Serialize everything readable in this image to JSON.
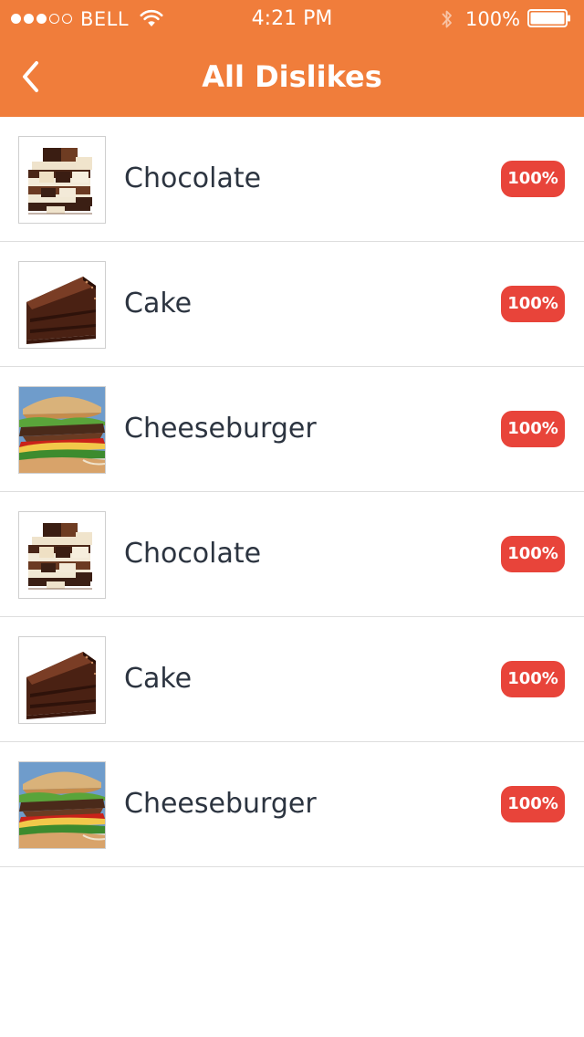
{
  "status_bar": {
    "carrier": "BELL",
    "time": "4:21 PM",
    "battery_percent": "100%",
    "signal_bars_filled": 3,
    "signal_bars_total": 5,
    "battery_level": 1.0
  },
  "nav": {
    "title": "All Dislikes",
    "back_icon": "chevron-left-icon"
  },
  "colors": {
    "header_background": "#f07d3b",
    "badge_background": "#e8443a",
    "text_primary": "#2c3440"
  },
  "items": [
    {
      "name": "Chocolate",
      "percentage": "100%",
      "image": "chocolate"
    },
    {
      "name": "Cake",
      "percentage": "100%",
      "image": "cake"
    },
    {
      "name": "Cheeseburger",
      "percentage": "100%",
      "image": "cheeseburger"
    },
    {
      "name": "Chocolate",
      "percentage": "100%",
      "image": "chocolate"
    },
    {
      "name": "Cake",
      "percentage": "100%",
      "image": "cake"
    },
    {
      "name": "Cheeseburger",
      "percentage": "100%",
      "image": "cheeseburger"
    }
  ]
}
